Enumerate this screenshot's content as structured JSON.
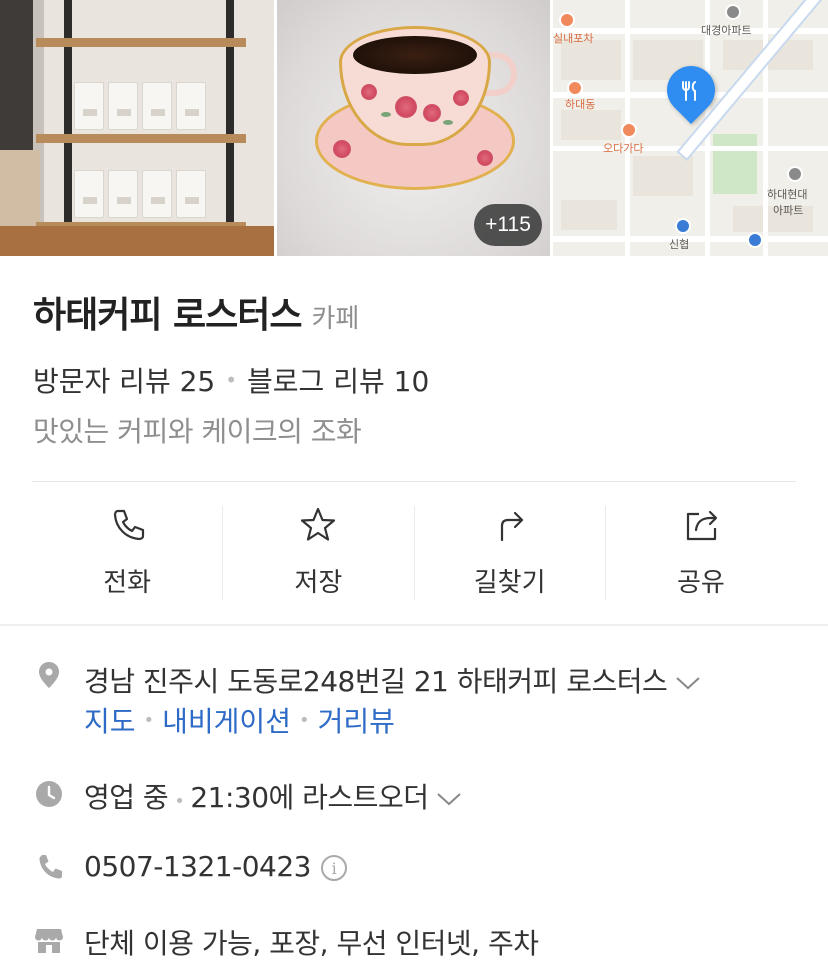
{
  "photos": {
    "more_count": "+115"
  },
  "map": {
    "labels": [
      "실내포차",
      "대경아파트",
      "하대동",
      "오다가다",
      "하대현대",
      "아파트",
      "신협"
    ],
    "pin_icon": "restaurant-icon"
  },
  "place": {
    "name": "하태커피 로스터스",
    "category": "카페",
    "visitor_reviews": "방문자 리뷰 25",
    "blog_reviews": "블로그 리뷰 10",
    "tagline": "맛있는 커피와 케이크의 조화"
  },
  "actions": [
    {
      "label": "전화",
      "icon": "phone-icon"
    },
    {
      "label": "저장",
      "icon": "star-icon"
    },
    {
      "label": "길찾기",
      "icon": "directions-icon"
    },
    {
      "label": "공유",
      "icon": "share-icon"
    }
  ],
  "info": {
    "address": "경남 진주시 도동로248번길 21 하태커피 로스터스",
    "address_links": [
      "지도",
      "내비게이션",
      "거리뷰"
    ],
    "hours_status": "영업 중",
    "hours_detail": "21:30에 라스트오더",
    "phone": "0507-1321-0423",
    "info_mark": "i",
    "amenities": "단체 이용 가능, 포장, 무선 인터넷, 주차"
  },
  "colors": {
    "link": "#2e6bc6",
    "pin": "#2f8cf0",
    "muted": "#8f8f8f",
    "icon_gray": "#a9a9a9"
  }
}
